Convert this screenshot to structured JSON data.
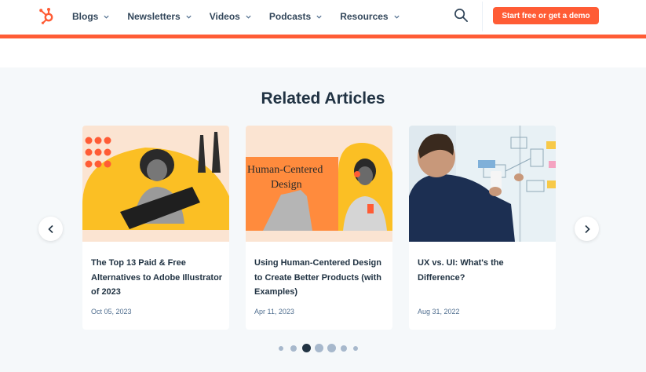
{
  "nav": {
    "logo_icon": "hubspot-sprocket-icon",
    "items": [
      {
        "label": "Blogs"
      },
      {
        "label": "Newsletters"
      },
      {
        "label": "Videos"
      },
      {
        "label": "Podcasts"
      },
      {
        "label": "Resources"
      }
    ],
    "search_icon": "search-icon",
    "cta_label": "Start free or get a demo"
  },
  "colors": {
    "accent": "#ff5c35",
    "heading": "#213343",
    "text": "#33475b",
    "muted": "#516f90",
    "background": "#f5f8fa",
    "dot_active": "#213343",
    "dot_inactive": "#a7b8cc"
  },
  "section": {
    "title": "Related Articles"
  },
  "articles": [
    {
      "title": "The Top 13 Paid & Free Alternatives to Adobe Illustrator of 2023",
      "date": "Oct 05, 2023"
    },
    {
      "title": "Using Human-Centered Design to Create Better Products (with Examples)",
      "date": "Apr 11, 2023",
      "image_text": "Human-Centered Design"
    },
    {
      "title": "UX vs. UI: What's the Difference?",
      "date": "Aug 31, 2022"
    }
  ],
  "carousel": {
    "prev_icon": "chevron-left-icon",
    "next_icon": "chevron-right-icon",
    "dot_count": 7,
    "active_dot": 2
  }
}
